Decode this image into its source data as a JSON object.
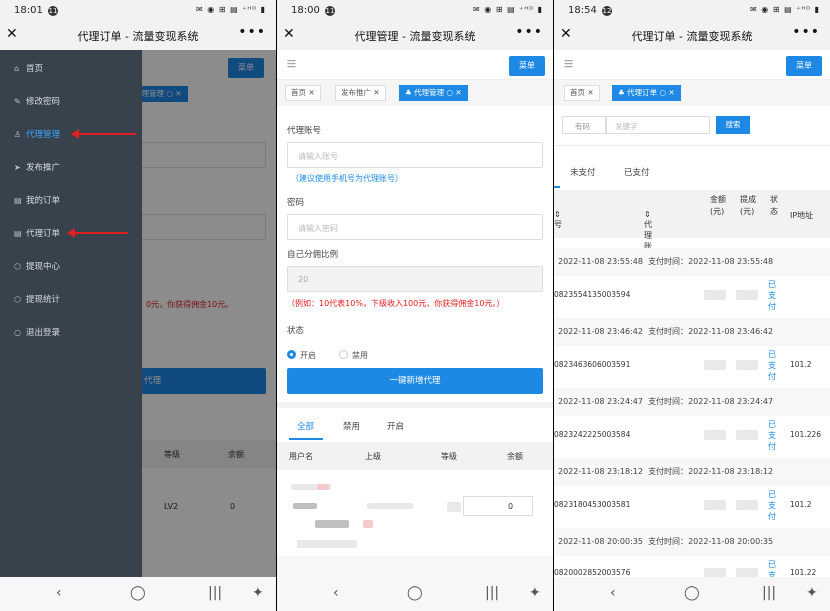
{
  "screens": [
    {
      "status_time": "18:01",
      "status_badge": "11",
      "window_title": "代理订单 - 流量变现系统",
      "menu_button": "菜单",
      "behind_tab": "代理管理",
      "behind_note": "0元，你获得佣金10元。",
      "behind_button": "代理",
      "behind_table": {
        "headers": [
          "等级",
          "余额"
        ],
        "row": [
          "LV2",
          "0"
        ]
      },
      "drawer_items": [
        {
          "label": "首页",
          "icon": "home-icon"
        },
        {
          "label": "修改密码",
          "icon": "edit-icon"
        },
        {
          "label": "代理管理",
          "icon": "user-icon"
        },
        {
          "label": "发布推广",
          "icon": "send-icon"
        },
        {
          "label": "我的订单",
          "icon": "document-icon"
        },
        {
          "label": "代理订单",
          "icon": "document-icon"
        },
        {
          "label": "提现中心",
          "icon": "cube-icon"
        },
        {
          "label": "提现统计",
          "icon": "cube-icon"
        },
        {
          "label": "退出登录",
          "icon": "logout-icon"
        }
      ]
    },
    {
      "status_time": "18:00",
      "status_badge": "11",
      "window_title": "代理管理 - 流量变现系统",
      "menu_button": "菜单",
      "tabs": [
        "首页",
        "发布推广",
        "代理管理"
      ],
      "form": {
        "account_label": "代理账号",
        "account_placeholder": "请输入账号",
        "account_hint": "（建议使用手机号为代理账号）",
        "password_label": "密码",
        "password_placeholder": "请输入密码",
        "ratio_label": "自己分佣比例",
        "ratio_value": "20",
        "ratio_hint": "（例如：10代表10%，下级收入100元，你获得佣金10元。）",
        "status_label": "状态",
        "status_on": "开启",
        "status_off": "禁用",
        "submit": "一键新增代理"
      },
      "filter_tabs": [
        "全部",
        "禁用",
        "开启"
      ],
      "table_headers": [
        "用户名",
        "上级",
        "等级",
        "余额"
      ],
      "row_balance": "0"
    },
    {
      "status_time": "18:54",
      "status_badge": "12",
      "window_title": "代理订单 - 流量变现系统",
      "menu_button": "菜单",
      "tabs": [
        "首页",
        "代理订单"
      ],
      "search": {
        "select": "有码",
        "placeholder": "关键字",
        "button": "搜索"
      },
      "pay_tabs": [
        "未支付",
        "已支付"
      ],
      "table_headers": [
        "号",
        "代理账号",
        "金额(元)",
        "提成(元)",
        "状态",
        "IP地址"
      ],
      "pay_time_label": "支付时间：",
      "orders": [
        {
          "created": "2022-11-08 23:55:48",
          "paid": "2022-11-08 23:55:48",
          "order_no": "0823554135003594",
          "status": "已支付",
          "ip": ""
        },
        {
          "created": "2022-11-08 23:46:42",
          "paid": "2022-11-08 23:46:42",
          "order_no": "0823463606003591",
          "status": "已支付",
          "ip": "101.2"
        },
        {
          "created": "2022-11-08 23:24:47",
          "paid": "2022-11-08 23:24:47",
          "order_no": "0823242225003584",
          "status": "已支付",
          "ip": "101.226"
        },
        {
          "created": "2022-11-08 23:18:12",
          "paid": "2022-11-08 23:18:12",
          "order_no": "0823180453003581",
          "status": "已支付",
          "ip": "101.2"
        },
        {
          "created": "2022-11-08 20:00:35",
          "paid": "2022-11-08 20:00:35",
          "order_no": "0820002852003576",
          "status": "已支",
          "ip": "101.22"
        }
      ]
    }
  ],
  "status_icons": "✉ ◉ ⊞ ▤ ⁺ᴴᴰ ▮",
  "colors": {
    "accent": "#1e88e5",
    "drawer": "#37424d",
    "warning": "#e02020"
  }
}
